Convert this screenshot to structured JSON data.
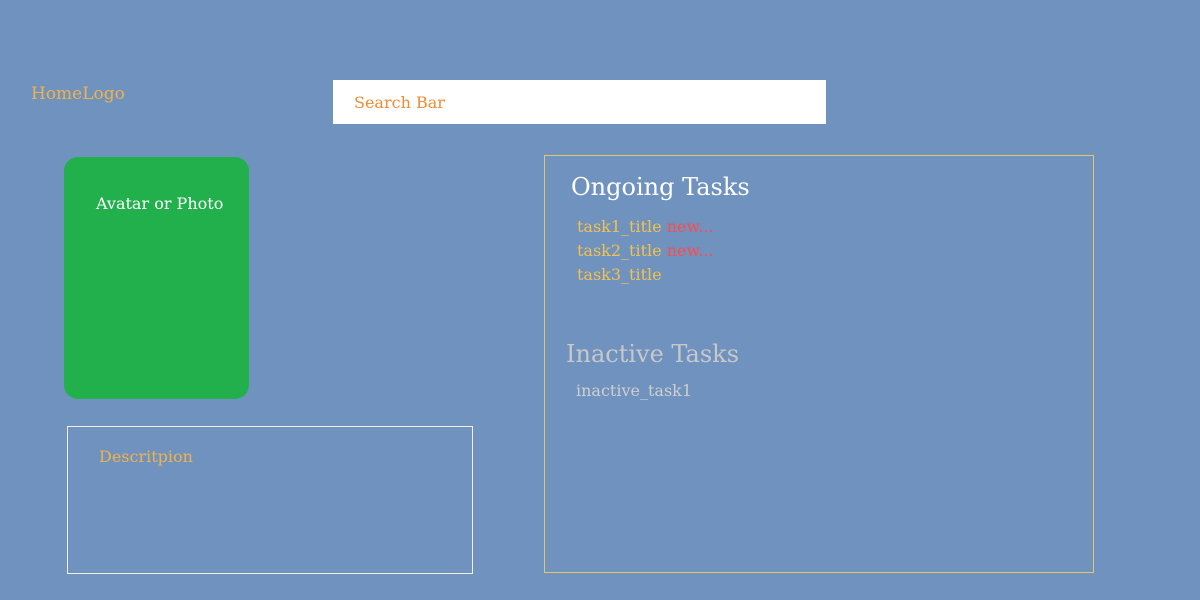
{
  "header": {
    "logo_text": "HomeLogo",
    "search_placeholder": "Search Bar"
  },
  "profile": {
    "avatar_label": "Avatar or Photo",
    "description_label": "Descritpion"
  },
  "tasks": {
    "ongoing_heading": "Ongoing Tasks",
    "ongoing": [
      {
        "title": "task1_title",
        "badge": "new..."
      },
      {
        "title": "task2_title",
        "badge": "new..."
      },
      {
        "title": "task3_title",
        "badge": ""
      }
    ],
    "inactive_heading": "Inactive Tasks",
    "inactive": [
      {
        "title": "inactive_task1"
      }
    ]
  },
  "colors": {
    "background": "#6f92bf",
    "logo": "#f2b24a",
    "search_text": "#f08a33",
    "avatar_fill": "#22b04c",
    "task_title": "#f2c14e",
    "new_badge": "#ff4a4a",
    "inactive_text": "#c8c8c8",
    "panel_border": "#e6c46a"
  }
}
